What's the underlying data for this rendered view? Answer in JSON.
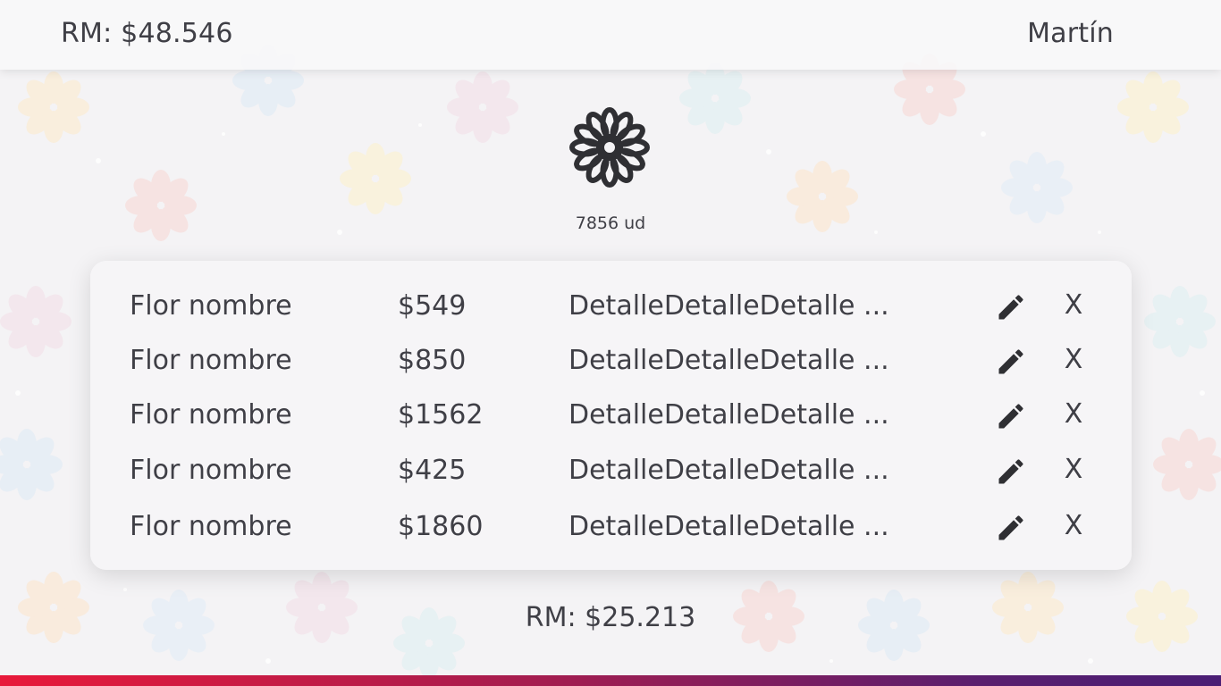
{
  "header": {
    "balance": "RM: $48.546",
    "username": "Martín"
  },
  "summary": {
    "units": "7856 ud",
    "icon": "flower-icon"
  },
  "table": {
    "rows": [
      {
        "name": "Flor nombre",
        "price": "$549",
        "detail": "DetalleDetalleDetalle ...",
        "edit_icon": "pencil-icon",
        "delete_label": "X"
      },
      {
        "name": "Flor nombre",
        "price": "$850",
        "detail": "DetalleDetalleDetalle ...",
        "edit_icon": "pencil-icon",
        "delete_label": "X"
      },
      {
        "name": "Flor nombre",
        "price": "$1562",
        "detail": "DetalleDetalleDetalle ...",
        "edit_icon": "pencil-icon",
        "delete_label": "X"
      },
      {
        "name": "Flor nombre",
        "price": "$425",
        "detail": "DetalleDetalleDetalle ...",
        "edit_icon": "pencil-icon",
        "delete_label": "X"
      },
      {
        "name": "Flor nombre",
        "price": "$1860",
        "detail": "DetalleDetalleDetalle ...",
        "edit_icon": "pencil-icon",
        "delete_label": "X"
      }
    ]
  },
  "footer": {
    "total": "RM: $25.213"
  },
  "colors": {
    "text": "#3f3f46",
    "accent_start": "#e8193a",
    "accent_end": "#4a1e74"
  }
}
